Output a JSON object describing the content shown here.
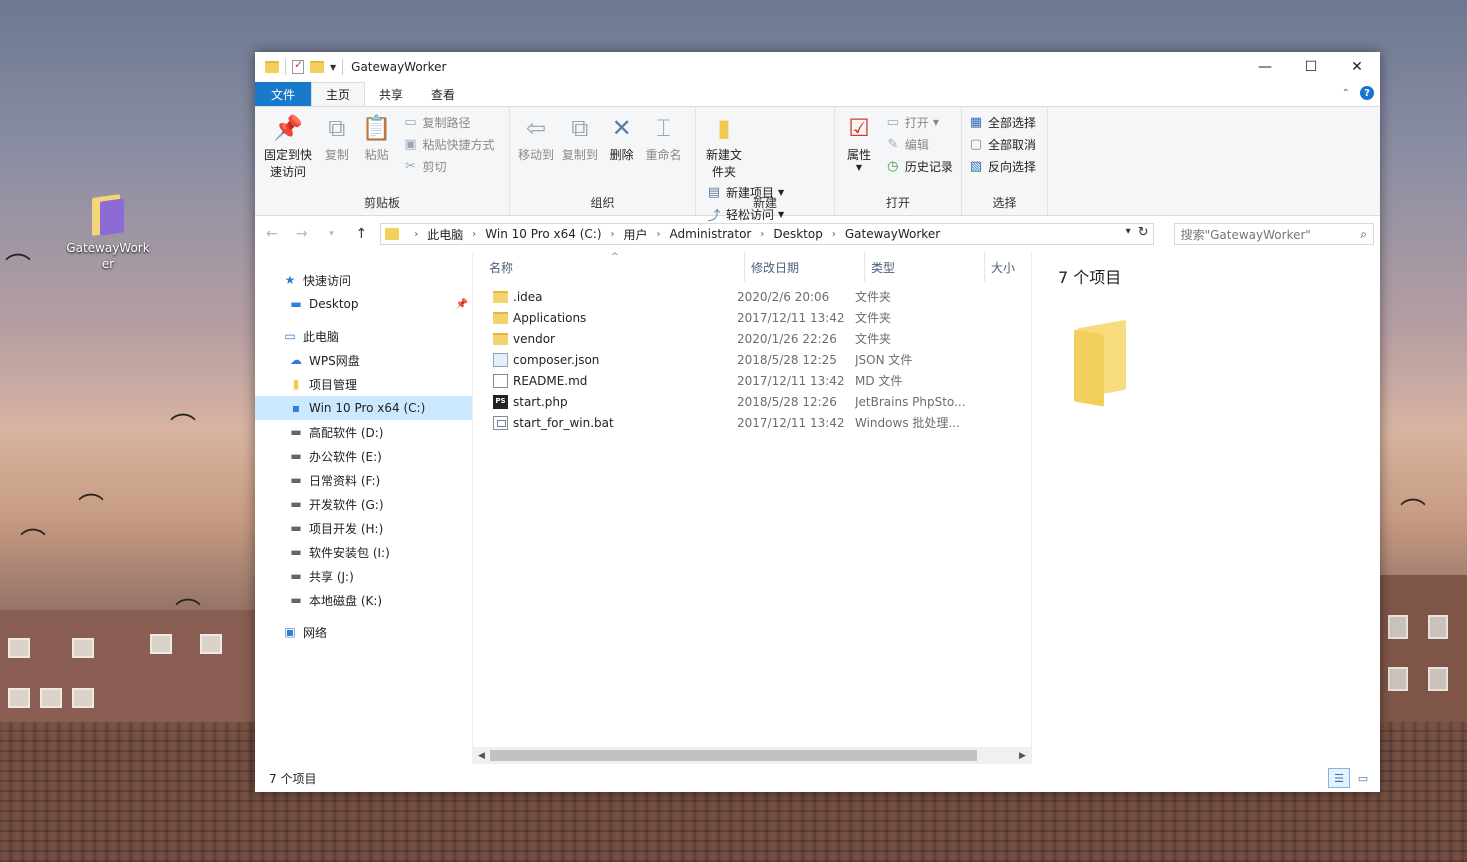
{
  "desktop": {
    "icon_label": "GatewayWorker"
  },
  "window": {
    "title": "GatewayWorker",
    "controls": {
      "minimize": "—",
      "maximize": "☐",
      "close": "✕"
    }
  },
  "tabs": [
    "文件",
    "主页",
    "共享",
    "查看"
  ],
  "ribbon": {
    "clipboard": {
      "label": "剪贴板",
      "pin": "固定到快速访问",
      "copy": "复制",
      "paste": "粘贴",
      "copy_path": "复制路径",
      "paste_shortcut": "粘贴快捷方式",
      "cut": "剪切"
    },
    "organize": {
      "label": "组织",
      "move_to": "移动到",
      "copy_to": "复制到",
      "delete": "删除",
      "rename": "重命名"
    },
    "new": {
      "label": "新建",
      "new_folder": "新建文件夹",
      "new_item": "新建项目",
      "easy_access": "轻松访问"
    },
    "open": {
      "label": "打开",
      "properties": "属性",
      "open": "打开",
      "edit": "编辑",
      "history": "历史记录"
    },
    "select": {
      "label": "选择",
      "select_all": "全部选择",
      "select_none": "全部取消",
      "invert": "反向选择"
    }
  },
  "address": {
    "crumbs": [
      "此电脑",
      "Win 10 Pro x64 (C:)",
      "用户",
      "Administrator",
      "Desktop",
      "GatewayWorker"
    ],
    "search_placeholder": "搜索\"GatewayWorker\""
  },
  "nav": {
    "quick_access": "快速访问",
    "desktop": "Desktop",
    "this_pc": "此电脑",
    "wps": "WPS网盘",
    "project_mgmt": "项目管理",
    "drives": [
      "Win 10 Pro x64 (C:)",
      "高配软件 (D:)",
      "办公软件 (E:)",
      "日常资料 (F:)",
      "开发软件 (G:)",
      "项目开发 (H:)",
      "软件安装包 (I:)",
      "共享 (J:)",
      "本地磁盘 (K:)"
    ],
    "network": "网络"
  },
  "columns": {
    "name": "名称",
    "modified": "修改日期",
    "type": "类型",
    "size": "大小"
  },
  "files": [
    {
      "name": ".idea",
      "modified": "2020/2/6 20:06",
      "type": "文件夹",
      "icon": "folder"
    },
    {
      "name": "Applications",
      "modified": "2017/12/11 13:42",
      "type": "文件夹",
      "icon": "folder"
    },
    {
      "name": "vendor",
      "modified": "2020/1/26 22:26",
      "type": "文件夹",
      "icon": "folder"
    },
    {
      "name": "composer.json",
      "modified": "2018/5/28 12:25",
      "type": "JSON 文件",
      "icon": "json"
    },
    {
      "name": "README.md",
      "modified": "2017/12/11 13:42",
      "type": "MD 文件",
      "icon": "md"
    },
    {
      "name": "start.php",
      "modified": "2018/5/28 12:26",
      "type": "JetBrains PhpSto...",
      "icon": "php"
    },
    {
      "name": "start_for_win.bat",
      "modified": "2017/12/11 13:42",
      "type": "Windows 批处理...",
      "icon": "bat"
    }
  ],
  "preview": {
    "count": "7 个项目"
  },
  "status": {
    "count": "7 个项目"
  }
}
